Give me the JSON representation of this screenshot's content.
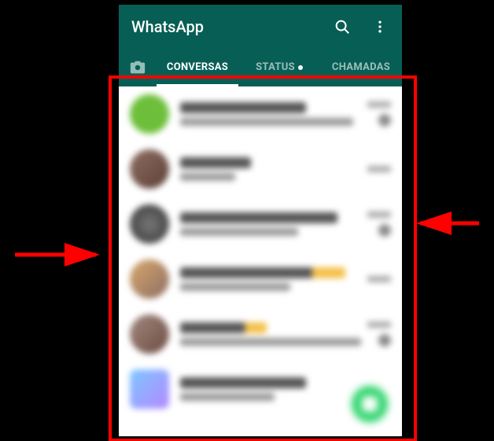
{
  "header": {
    "title": "WhatsApp"
  },
  "tabs": {
    "conversas": "CONVERSAS",
    "status": "STATUS",
    "chamadas": "CHAMADAS"
  }
}
